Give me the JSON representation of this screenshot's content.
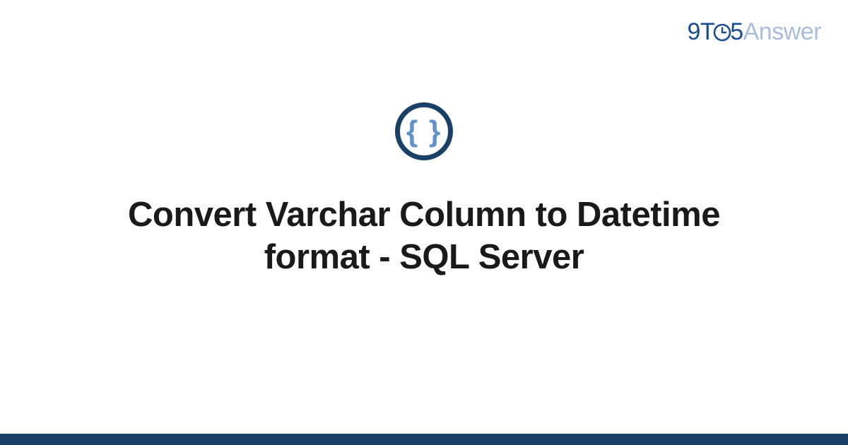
{
  "brand": {
    "part1": "9",
    "part2": "T",
    "part3": "5",
    "part4": "Answer"
  },
  "icon": {
    "name": "code-braces-icon",
    "glyph": "{ }"
  },
  "title": "Convert Varchar Column to Datetime format - SQL Server",
  "colors": {
    "brand_primary": "#1a4d8f",
    "brand_muted": "#a7bdd9",
    "ring": "#1a4068",
    "braces": "#5f93c9",
    "bottom_bar": "#1a4068"
  }
}
